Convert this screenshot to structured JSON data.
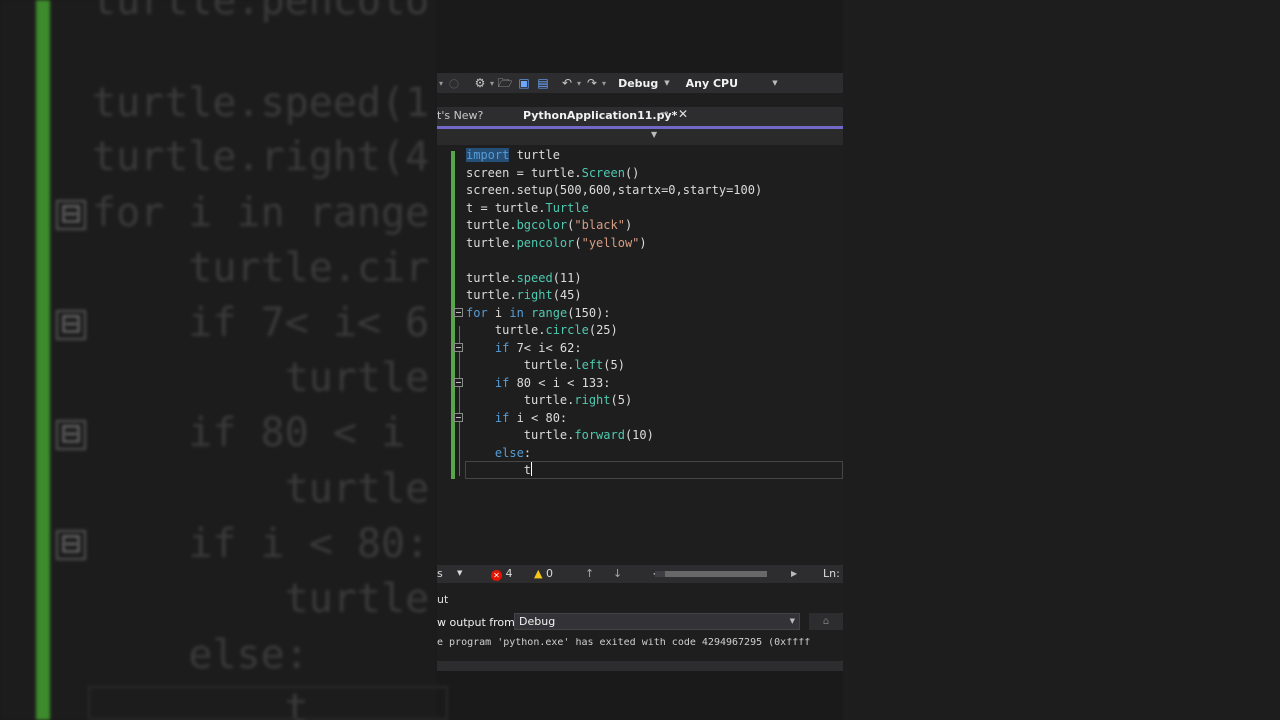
{
  "background": {
    "lines": [
      {
        "text": "turtle.pencolo"
      },
      {
        "text": "turtle.speed(1"
      },
      {
        "text": "turtle.right(4"
      },
      {
        "text": "for i in range"
      },
      {
        "text": "    turtle.cir"
      },
      {
        "text": "    if 7< i< 6"
      },
      {
        "text": "        turtle"
      },
      {
        "text": "    if 80 < i"
      },
      {
        "text": "        turtle"
      },
      {
        "text": "    if i < 80:"
      },
      {
        "text": "        turtle"
      },
      {
        "text": "    else:"
      },
      {
        "text": "        t"
      }
    ],
    "fold_glyph": "⊟"
  },
  "toolbar": {
    "config_dropdown": "Debug",
    "platform_dropdown": "Any CPU",
    "icons": [
      "arrow-icon",
      "circle-icon",
      "settings-icon",
      "open-folder-icon",
      "save-icon",
      "save-all-icon",
      "undo-icon",
      "redo-icon"
    ]
  },
  "tabs": {
    "whats_new": "t's New?",
    "active": "PythonApplication11.py*",
    "pin_glyph": "⊸",
    "close_glyph": "✕"
  },
  "editor": {
    "lines": [
      [
        {
          "t": "import",
          "c": "kw"
        },
        {
          "t": " turtle",
          "c": ""
        }
      ],
      [
        {
          "t": "screen = turtle.",
          "c": ""
        },
        {
          "t": "Screen",
          "c": "fn"
        },
        {
          "t": "()",
          "c": ""
        }
      ],
      [
        {
          "t": "screen.setup(500,600,startx=0,starty=100)",
          "c": ""
        }
      ],
      [
        {
          "t": "t = turtle.",
          "c": ""
        },
        {
          "t": "Turtle",
          "c": "fn"
        }
      ],
      [
        {
          "t": "turtle.",
          "c": ""
        },
        {
          "t": "bgcolor",
          "c": "fn"
        },
        {
          "t": "(",
          "c": ""
        },
        {
          "t": "\"black\"",
          "c": "st"
        },
        {
          "t": ")",
          "c": ""
        }
      ],
      [
        {
          "t": "turtle.",
          "c": ""
        },
        {
          "t": "pencolor",
          "c": "fn"
        },
        {
          "t": "(",
          "c": ""
        },
        {
          "t": "\"yellow\"",
          "c": "st"
        },
        {
          "t": ")",
          "c": ""
        }
      ],
      [
        {
          "t": "",
          "c": ""
        }
      ],
      [
        {
          "t": "turtle.",
          "c": ""
        },
        {
          "t": "speed",
          "c": "fn"
        },
        {
          "t": "(11)",
          "c": ""
        }
      ],
      [
        {
          "t": "turtle.",
          "c": ""
        },
        {
          "t": "right",
          "c": "fn"
        },
        {
          "t": "(45)",
          "c": ""
        }
      ],
      [
        {
          "t": "for",
          "c": "kw"
        },
        {
          "t": " i ",
          "c": ""
        },
        {
          "t": "in",
          "c": "kw"
        },
        {
          "t": " ",
          "c": ""
        },
        {
          "t": "range",
          "c": "fn"
        },
        {
          "t": "(150):",
          "c": ""
        }
      ],
      [
        {
          "t": "    turtle.",
          "c": ""
        },
        {
          "t": "circle",
          "c": "fn"
        },
        {
          "t": "(25)",
          "c": ""
        }
      ],
      [
        {
          "t": "    ",
          "c": ""
        },
        {
          "t": "if",
          "c": "kw"
        },
        {
          "t": " 7< i< 62:",
          "c": ""
        }
      ],
      [
        {
          "t": "        turtle.",
          "c": ""
        },
        {
          "t": "left",
          "c": "fn"
        },
        {
          "t": "(5)",
          "c": ""
        }
      ],
      [
        {
          "t": "    ",
          "c": ""
        },
        {
          "t": "if",
          "c": "kw"
        },
        {
          "t": " 80 < i < 133:",
          "c": ""
        }
      ],
      [
        {
          "t": "        turtle.",
          "c": ""
        },
        {
          "t": "right",
          "c": "fn"
        },
        {
          "t": "(5)",
          "c": ""
        }
      ],
      [
        {
          "t": "    ",
          "c": ""
        },
        {
          "t": "if",
          "c": "kw"
        },
        {
          "t": " i < 80:",
          "c": ""
        }
      ],
      [
        {
          "t": "        turtle.",
          "c": ""
        },
        {
          "t": "forward",
          "c": "fn"
        },
        {
          "t": "(10)",
          "c": ""
        }
      ],
      [
        {
          "t": "    ",
          "c": ""
        },
        {
          "t": "else",
          "c": "kw"
        },
        {
          "t": ":",
          "c": ""
        }
      ],
      [
        {
          "t": "        t",
          "c": ""
        }
      ]
    ],
    "colors": {
      "keyword": "#569cd6",
      "function": "#4ec9b0",
      "string": "#d69d85",
      "changed_bar": "#57a64a",
      "tab_accent": "#7268c8"
    }
  },
  "status": {
    "left_fragment": "s",
    "errors": "4",
    "warnings": "0",
    "position_label": "Ln:"
  },
  "output": {
    "title": "ut",
    "show_output_from_label": "w output from:",
    "source": "Debug",
    "text": "e program 'python.exe' has exited with code 4294967295 (0xffff"
  }
}
